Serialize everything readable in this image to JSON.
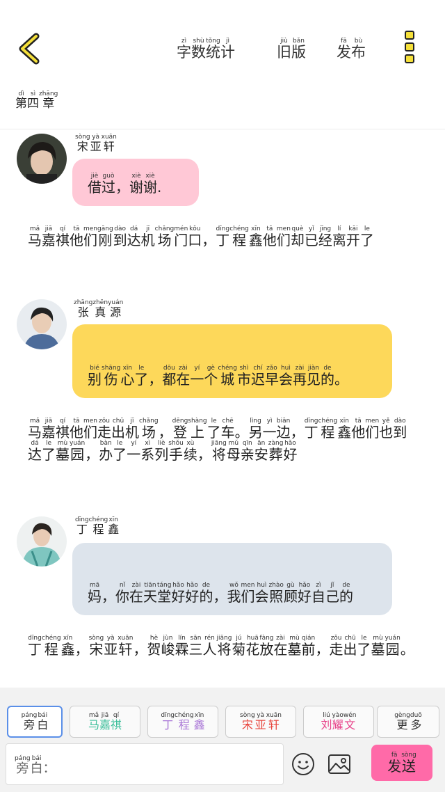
{
  "header": {
    "stats": {
      "chars": [
        "字",
        "数",
        "统",
        "计"
      ],
      "pinyin": [
        "zì",
        "shù",
        "tǒng",
        "jì"
      ]
    },
    "old_version": {
      "chars": [
        "旧",
        "版"
      ],
      "pinyin": [
        "jiù",
        "bǎn"
      ]
    },
    "publish": {
      "chars": [
        "发",
        "布"
      ],
      "pinyin": [
        "fā",
        "bù"
      ]
    }
  },
  "chapter": {
    "chars": [
      "第",
      "四",
      "章"
    ],
    "pinyin": [
      "dì",
      "sì",
      "zhāng"
    ]
  },
  "messages": [
    {
      "speaker": {
        "chars": [
          "宋",
          "亚",
          "轩"
        ],
        "pinyin": [
          "sòng",
          "yà",
          "xuān"
        ]
      },
      "text": {
        "chars": [
          "借",
          "过",
          "，",
          "谢",
          "谢",
          "."
        ],
        "pinyin": [
          "jiè",
          "guò",
          "",
          "xiè",
          "xiè",
          ""
        ]
      },
      "bubble_color": "#ffc8d6"
    },
    {
      "speaker": {
        "chars": [
          "张",
          "真",
          "源"
        ],
        "pinyin": [
          "zhāng",
          "zhēn",
          "yuán"
        ]
      },
      "text": {
        "chars": [
          "别",
          "伤",
          "心",
          "了",
          "，",
          "都",
          "在",
          "一",
          "个",
          "城",
          "市",
          "迟",
          "早",
          "会",
          "再",
          "见",
          "的",
          "。"
        ],
        "pinyin": [
          "bié",
          "shāng",
          "xīn",
          "le",
          "",
          "dōu",
          "zài",
          "yí",
          "gè",
          "chéng",
          "shì",
          "chí",
          "zǎo",
          "huì",
          "zài",
          "jiàn",
          "de",
          ""
        ]
      },
      "bubble_color": "#fdd85a"
    },
    {
      "speaker": {
        "chars": [
          "丁",
          "程",
          "鑫"
        ],
        "pinyin": [
          "dīng",
          "chéng",
          "xīn"
        ]
      },
      "text": {
        "chars": [
          "妈",
          "，",
          "你",
          "在",
          "天",
          "堂",
          "好",
          "好",
          "的",
          "，",
          "我",
          "们",
          "会",
          "照",
          "顾",
          "好",
          "自",
          "己",
          "的"
        ],
        "pinyin": [
          "mā",
          "",
          "nǐ",
          "zài",
          "tiān",
          "táng",
          "hǎo",
          "hǎo",
          "de",
          "",
          "wǒ",
          "men",
          "huì",
          "zhào",
          "gù",
          "hǎo",
          "zì",
          "jǐ",
          "de"
        ]
      },
      "bubble_color": "#dde4ec"
    }
  ],
  "narrations": [
    {
      "chars": [
        "马",
        "嘉",
        "祺",
        "他",
        "们",
        "刚",
        "到",
        "达",
        "机",
        "场",
        "门",
        "口",
        "，",
        "丁",
        "程",
        "鑫",
        "他",
        "们",
        "却",
        "已",
        "经",
        "离",
        "开",
        "了"
      ],
      "pinyin": [
        "mǎ",
        "jiā",
        "qí",
        "tā",
        "men",
        "gāng",
        "dào",
        "dá",
        "jī",
        "chǎng",
        "mén",
        "kǒu",
        "",
        "dīng",
        "chéng",
        "xīn",
        "tā",
        "men",
        "què",
        "yǐ",
        "jīng",
        "lí",
        "kāi",
        "le"
      ]
    },
    {
      "chars": [
        "马",
        "嘉",
        "祺",
        "他",
        "们",
        "走",
        "出",
        "机",
        "场",
        "，",
        "登",
        "上",
        "了",
        "车",
        "。",
        "另",
        "一",
        "边",
        "，",
        "丁",
        "程",
        "鑫",
        "他",
        "们",
        "也",
        "到",
        "达",
        "了",
        "墓",
        "园",
        "，",
        "办",
        "了",
        "一",
        "系",
        "列",
        "手",
        "续",
        "，",
        "将",
        "母",
        "亲",
        "安",
        "葬",
        "好"
      ],
      "pinyin": [
        "mǎ",
        "jiā",
        "qí",
        "tā",
        "men",
        "zǒu",
        "chū",
        "jī",
        "chǎng",
        "",
        "dēng",
        "shàng",
        "le",
        "chē",
        "",
        "lìng",
        "yì",
        "biān",
        "",
        "dīng",
        "chéng",
        "xīn",
        "tā",
        "men",
        "yě",
        "dào",
        "dá",
        "le",
        "mù",
        "yuán",
        "",
        "bàn",
        "le",
        "yí",
        "xì",
        "liè",
        "shǒu",
        "xù",
        "",
        "jiāng",
        "mǔ",
        "qīn",
        "ān",
        "zàng",
        "hǎo"
      ]
    },
    {
      "chars": [
        "丁",
        "程",
        "鑫",
        "，",
        "宋",
        "亚",
        "轩",
        "，",
        "贺",
        "峻",
        "霖",
        "三",
        "人",
        "将",
        "菊",
        "花",
        "放",
        "在",
        "墓",
        "前",
        "，",
        "走",
        "出",
        "了",
        "墓",
        "园",
        "。"
      ],
      "pinyin": [
        "dīng",
        "chéng",
        "xīn",
        "",
        "sòng",
        "yà",
        "xuān",
        "",
        "hè",
        "jùn",
        "lín",
        "sān",
        "rén",
        "jiāng",
        "jú",
        "huā",
        "fàng",
        "zài",
        "mù",
        "qián",
        "",
        "zǒu",
        "chū",
        "le",
        "mù",
        "yuán",
        ""
      ]
    }
  ],
  "roles": [
    {
      "chars": [
        "旁",
        "白"
      ],
      "pinyin": [
        "páng",
        "bái"
      ],
      "color": "#333333"
    },
    {
      "chars": [
        "马",
        "嘉",
        "祺"
      ],
      "pinyin": [
        "mǎ",
        "jiā",
        "qí"
      ],
      "color": "#3bbf9a"
    },
    {
      "chars": [
        "丁",
        "程",
        "鑫"
      ],
      "pinyin": [
        "dīng",
        "chéng",
        "xīn"
      ],
      "color": "#a874d6"
    },
    {
      "chars": [
        "宋",
        "亚",
        "轩"
      ],
      "pinyin": [
        "sòng",
        "yà",
        "xuān"
      ],
      "color": "#e8453c"
    },
    {
      "chars": [
        "刘",
        "耀",
        "文"
      ],
      "pinyin": [
        "liú",
        "yào",
        "wén"
      ],
      "color": "#e8438a"
    },
    {
      "chars": [
        "更",
        "多"
      ],
      "pinyin": [
        "gèng",
        "duō"
      ],
      "color": "#333333"
    }
  ],
  "input": {
    "chars": [
      "旁",
      "白",
      "："
    ],
    "pinyin": [
      "páng",
      "bái",
      ""
    ]
  },
  "send": {
    "chars": [
      "发",
      "送"
    ],
    "pinyin": [
      "fā",
      "sòng"
    ]
  },
  "icons": {
    "back": "chevron-left-icon",
    "menu": "menu-icon",
    "emoji": "emoji-icon",
    "image": "image-icon"
  },
  "colors": {
    "back_accent": "#f5e03a",
    "send_bg": "#ff6aa8"
  }
}
